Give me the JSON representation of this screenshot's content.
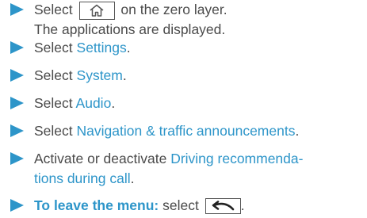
{
  "steps": [
    {
      "select_label": "Select",
      "after_text": "on the zero layer.",
      "icon": "home-icon",
      "result_text": "The applications are displayed."
    },
    {
      "prefix": "Select",
      "target": "Settings",
      "suffix": "."
    },
    {
      "prefix": "Select",
      "target": "System",
      "suffix": "."
    },
    {
      "prefix": "Select",
      "target": "Audio",
      "suffix": "."
    },
    {
      "prefix": "Select",
      "target": "Navigation & traffic announcements",
      "suffix": "."
    },
    {
      "prefix": "Activate or deactivate",
      "target_line1": "Driving recommenda-",
      "target_line2": "tions during call",
      "suffix": "."
    },
    {
      "label": "To leave the menu:",
      "select_label": "select",
      "icon": "back-icon",
      "suffix": "."
    }
  ],
  "colors": {
    "accent": "#2d95c9",
    "text": "#4a4a4a"
  }
}
